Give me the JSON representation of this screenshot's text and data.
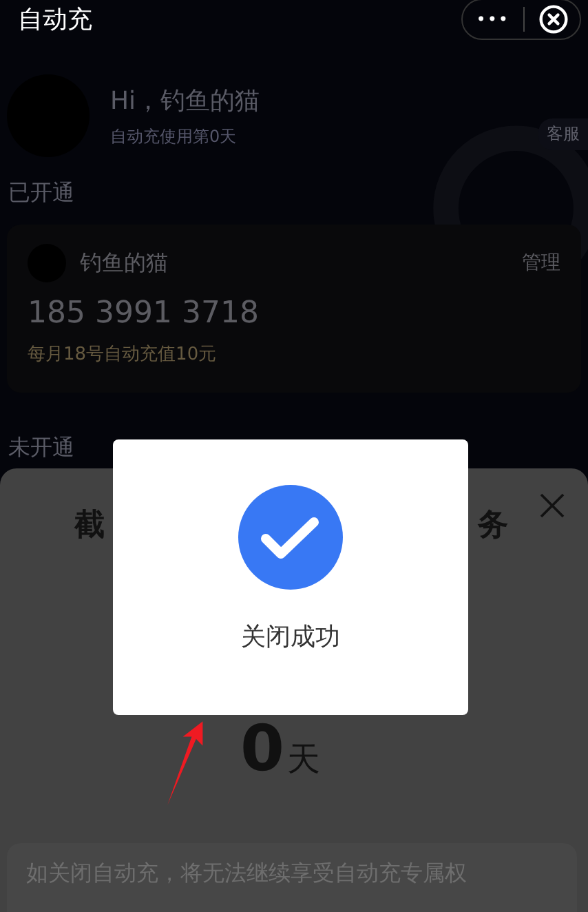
{
  "top_bar": {
    "title": "自动充",
    "more": "•••"
  },
  "profile": {
    "greeting": "Hi，钓鱼的猫",
    "subtitle": "自动充使用第0天",
    "service": "客服"
  },
  "opened_section": {
    "heading": "已开通"
  },
  "account_card": {
    "name": "钓鱼的猫",
    "action": "管理",
    "phone": "185 3991 3718",
    "plan": "每月18号自动充值10元"
  },
  "closed_section": {
    "heading": "未开通"
  },
  "sheet": {
    "title_visible_start": "截",
    "title_visible_end": "务",
    "days_number": "0",
    "days_unit": "天",
    "notice": "如关闭自动充，将无法继续享受自动充专属权"
  },
  "toast": {
    "message": "关闭成功"
  }
}
